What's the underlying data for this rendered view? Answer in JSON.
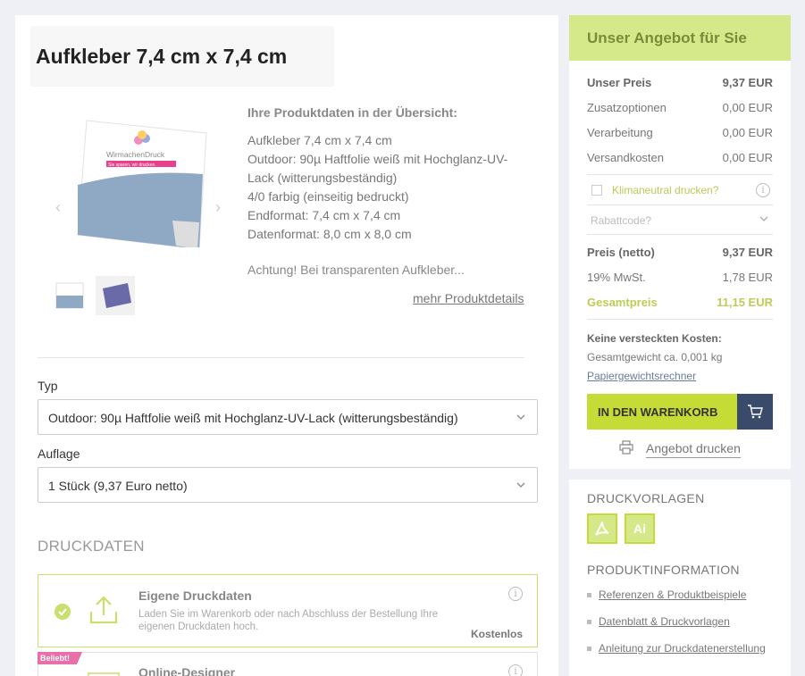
{
  "product": {
    "title": "Aufkleber 7,4 cm x 7,4 cm",
    "overview_heading": "Ihre Produktdaten in der Übersicht:",
    "lines": [
      "Aufkleber 7,4 cm x 7,4 cm",
      "Outdoor: 90µ Haftfolie weiß mit Hochglanz-UV-Lack (witterungsbeständig)",
      "4/0 farbig (einseitig bedruckt)",
      "Endformat: 7,4 cm x 7,4 cm",
      "Datenformat: 8,0 cm x 8,0 cm"
    ],
    "warning": "Achtung! Bei transparenten Aufkleber...",
    "more_link": "mehr Produktdetails",
    "gallery_prev": "‹",
    "gallery_next": "›",
    "sticker_brand": "WirmachenDruck",
    "sticker_tagline": "Sie sparen, wir drucken."
  },
  "form": {
    "typ_label": "Typ",
    "typ_value": "Outdoor: 90µ Haftfolie weiß mit Hochglanz-UV-Lack (witterungsbeständig)",
    "auflage_label": "Auflage",
    "auflage_value": "1 Stück (9,37 Euro netto)"
  },
  "druckdaten": {
    "heading": "DRUCKDATEN",
    "own": {
      "title": "Eigene Druckdaten",
      "desc": "Laden Sie im Warenkorb oder nach Abschluss der Bestellung Ihre eigenen Druckdaten hoch.",
      "price": "Kostenlos",
      "info": "i"
    },
    "designer": {
      "badge": "Beliebt!",
      "title": "Online-Designer",
      "info": "i"
    }
  },
  "offer": {
    "heading": "Unser Angebot für Sie",
    "rows": [
      {
        "label": "Unser Preis",
        "value": "9,37 EUR"
      },
      {
        "label": "Zusatzoptionen",
        "value": "0,00 EUR"
      },
      {
        "label": "Verarbeitung",
        "value": "0,00 EUR"
      },
      {
        "label": "Versandkosten",
        "value": "0,00 EUR"
      }
    ],
    "klima_label": "Klimaneutral drucken?",
    "klima_info": "i",
    "rabatt_placeholder": "Rabattcode?",
    "totals": [
      {
        "label": "Preis (netto)",
        "value": "9,37 EUR"
      },
      {
        "label": "19% MwSt.",
        "value": "1,78 EUR"
      },
      {
        "label": "Gesamtpreis",
        "value": "11,15 EUR"
      }
    ],
    "no_hidden": "Keine versteckten Kosten:",
    "weight": "Gesamtgewicht ca. 0,001 kg",
    "weight_calc": "Papiergewichtsrechner",
    "cart_button": "IN DEN WARENKORB",
    "print_offer": "Angebot drucken"
  },
  "resources": {
    "vorlagen_heading": "DRUCKVORLAGEN",
    "formats": [
      "PDF",
      "Ai"
    ],
    "info_heading": "PRODUKTINFORMATION",
    "links": [
      "Referenzen & Produktbeispiele",
      "Datenblatt & Druckvorlagen",
      "Anleitung zur Druckdatenerstellung"
    ]
  },
  "colors": {
    "accent_green": "#c4dc35",
    "header_green": "#d6e98a",
    "navy": "#3a4a6a",
    "badge_pink": "#e96fa8"
  }
}
